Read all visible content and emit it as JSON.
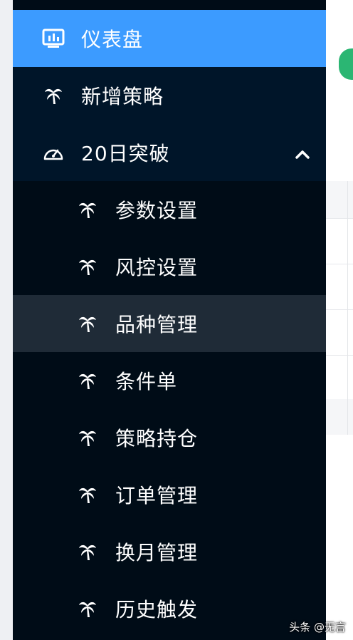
{
  "sidebar": {
    "dashboard": {
      "label": "仪表盘",
      "icon": "dashboard-chart-icon"
    },
    "new_strategy": {
      "label": "新增策略",
      "icon": "palm-icon"
    },
    "breakout": {
      "label": "20日突破",
      "icon": "gauge-icon",
      "expanded": true
    },
    "submenu": [
      {
        "label": "参数设置",
        "icon": "palm-icon"
      },
      {
        "label": "风控设置",
        "icon": "palm-icon"
      },
      {
        "label": "品种管理",
        "icon": "palm-icon"
      },
      {
        "label": "条件单",
        "icon": "palm-icon"
      },
      {
        "label": "策略持仓",
        "icon": "palm-icon"
      },
      {
        "label": "订单管理",
        "icon": "palm-icon"
      },
      {
        "label": "换月管理",
        "icon": "palm-icon"
      },
      {
        "label": "历史触发",
        "icon": "palm-icon"
      }
    ]
  },
  "watermark": "头条 @无言",
  "colors": {
    "sidebar_bg": "#001529",
    "submenu_bg": "#000c17",
    "active_bg": "#3c9bff",
    "hover_bg": "#1f2b37",
    "accent_green": "#2bb673"
  }
}
